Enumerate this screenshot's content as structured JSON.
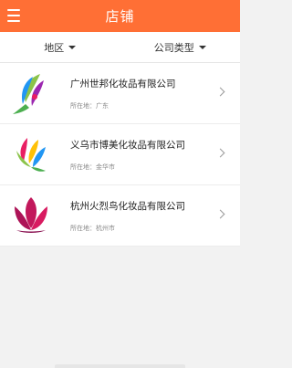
{
  "header": {
    "title": "店铺",
    "menu_icon": "hamburger-menu-icon"
  },
  "filters": [
    {
      "label": "地区"
    },
    {
      "label": "公司类型"
    }
  ],
  "companies": [
    {
      "name": "广州世邦化妆品有限公司",
      "location": "所在地：广东"
    },
    {
      "name": "义乌市博美化妆品有限公司",
      "location": "所在地：金华市"
    },
    {
      "name": "杭州火烈鸟化妆品有限公司",
      "location": "所在地：杭州市"
    }
  ],
  "colors": {
    "accent": "#ff6f35"
  }
}
